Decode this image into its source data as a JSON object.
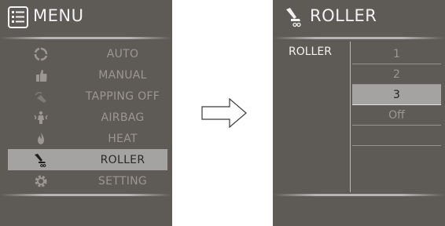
{
  "left": {
    "title": "MENU",
    "title_icon": "list-menu-icon",
    "items": [
      {
        "label": "AUTO",
        "icon": "cycle-icon"
      },
      {
        "label": "MANUAL",
        "icon": "hand-icon"
      },
      {
        "label": "TAPPING OFF",
        "icon": "tapping-icon"
      },
      {
        "label": "AIRBAG",
        "icon": "airbag-icon"
      },
      {
        "label": "HEAT",
        "icon": "flame-icon"
      },
      {
        "label": "ROLLER",
        "icon": "roller-icon",
        "selected": true
      },
      {
        "label": "SETTING",
        "icon": "gear-icon"
      }
    ]
  },
  "right": {
    "title": "ROLLER",
    "title_icon": "roller-icon",
    "row_label": "ROLLER",
    "options": [
      "1",
      "2",
      "3",
      "Off"
    ],
    "selected_option": "3"
  },
  "arrow_icon": "right-arrow-icon",
  "colors": {
    "panel_bg": "#5e5a56",
    "highlight_bg": "#a5a3a2",
    "dim_text": "#9c9792",
    "bright_text": "#f2f2f2"
  }
}
